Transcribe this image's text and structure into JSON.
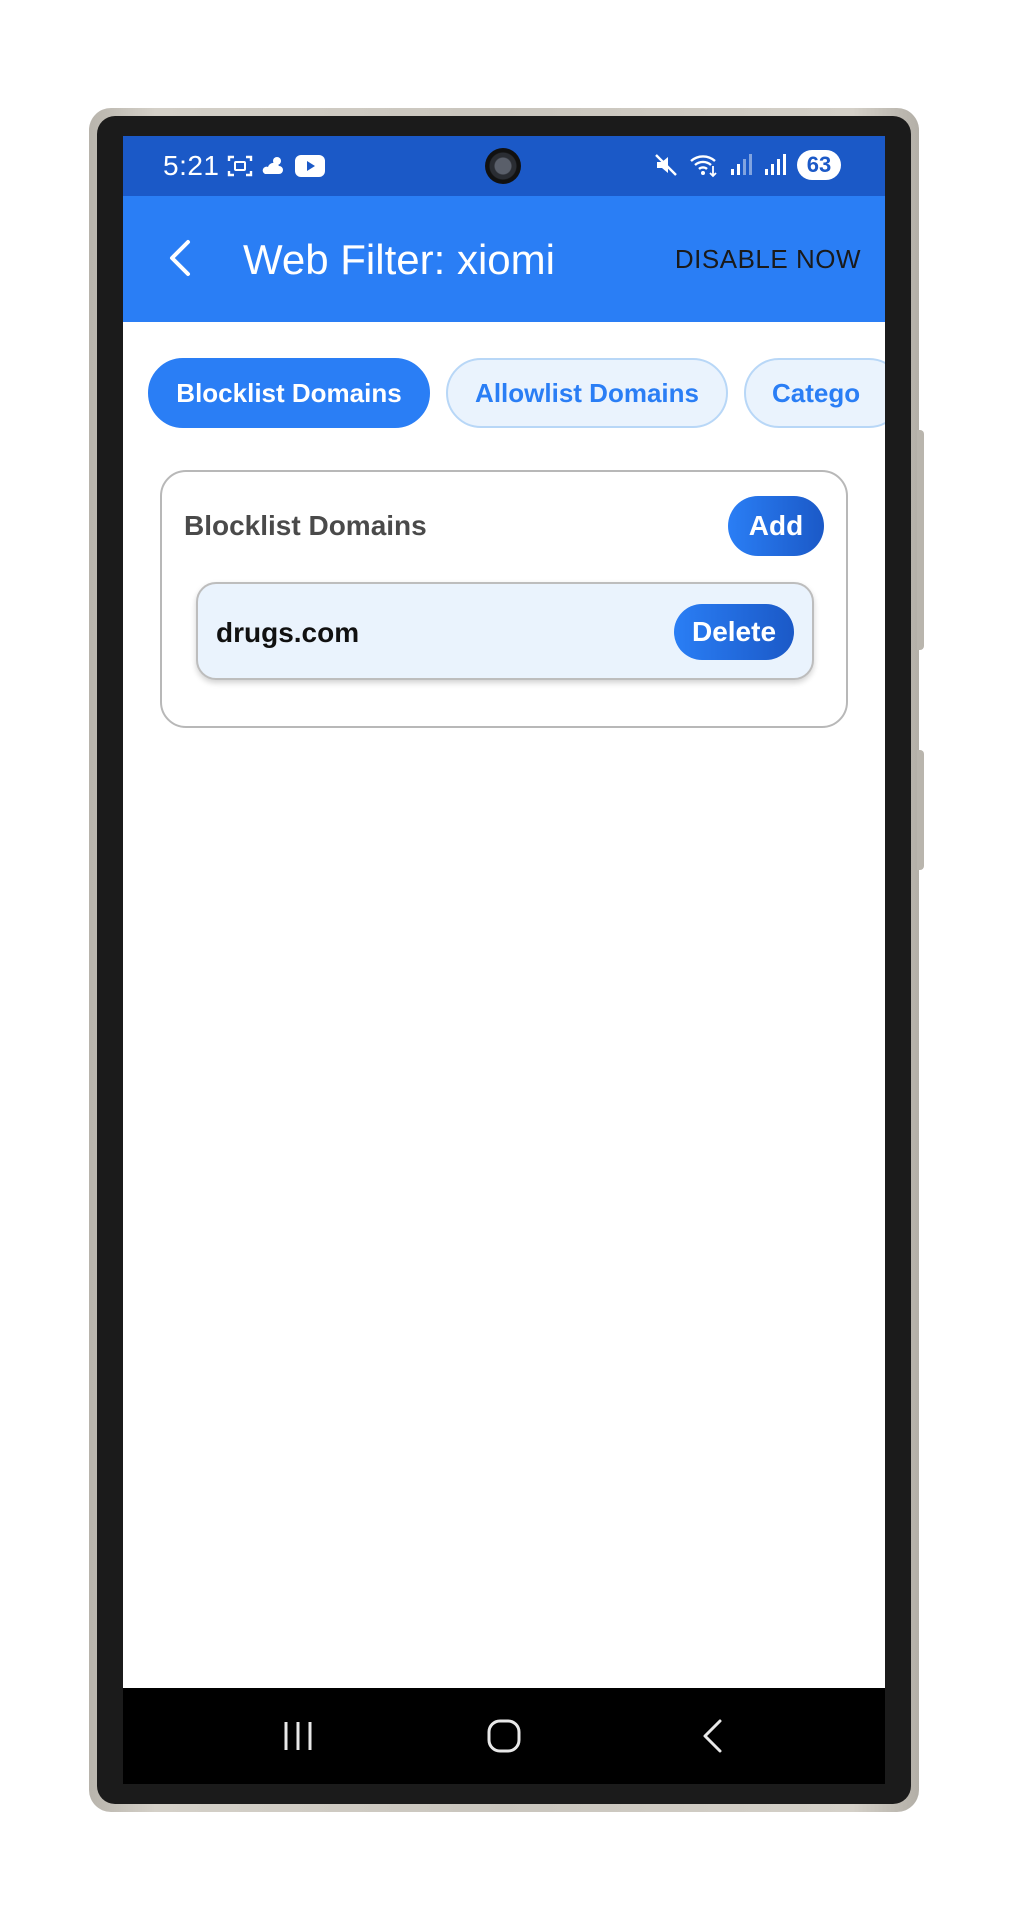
{
  "status_bar": {
    "time": "5:21",
    "battery": "63",
    "left_icons": [
      "screenshot-icon",
      "weather-icon",
      "youtube-icon"
    ],
    "right_icons": [
      "mute-icon",
      "wifi-icon",
      "signal-icon",
      "signal-icon"
    ]
  },
  "app_bar": {
    "title": "Web Filter: xiomi",
    "action_label": "DISABLE NOW"
  },
  "tabs": [
    {
      "label": "Blocklist Domains",
      "active": true
    },
    {
      "label": "Allowlist Domains",
      "active": false
    },
    {
      "label": "Catego",
      "active": false
    }
  ],
  "card": {
    "title": "Blocklist Domains",
    "add_label": "Add",
    "domains": [
      {
        "domain": "drugs.com",
        "delete_label": "Delete"
      }
    ]
  },
  "colors": {
    "status_bar": "#1b59c7",
    "app_bar": "#2a7ef5",
    "tab_inactive_bg": "#eaf3fd",
    "row_bg": "#eaf3fd"
  }
}
